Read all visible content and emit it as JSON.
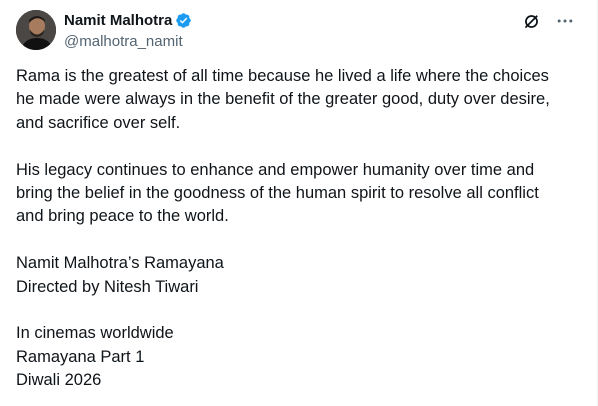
{
  "author": {
    "display_name": "Namit Malhotra",
    "handle": "@malhotra_namit",
    "verified": true
  },
  "icons": {
    "verified": "verified-badge-icon",
    "grok": "grok-icon",
    "more": "more-options-icon"
  },
  "colors": {
    "verified": "#1d9bf0",
    "text": "#0f1419",
    "secondary": "#536471"
  },
  "tweet": {
    "paragraph1": [
      "Rama is the greatest of all time because he lived a life where the choices",
      "he made were always in the benefit of the greater good, duty over desire,",
      "and sacrifice over self."
    ],
    "paragraph2": [
      "His legacy continues to enhance and empower humanity over time and",
      "bring the belief in the goodness of the human spirit to resolve all conflict",
      "and bring peace to the world."
    ],
    "paragraph3": [
      "Namit Malhotra’s Ramayana",
      "Directed by Nitesh Tiwari"
    ],
    "paragraph4": [
      "In cinemas worldwide",
      "Ramayana Part 1",
      "Diwali 2026"
    ]
  }
}
